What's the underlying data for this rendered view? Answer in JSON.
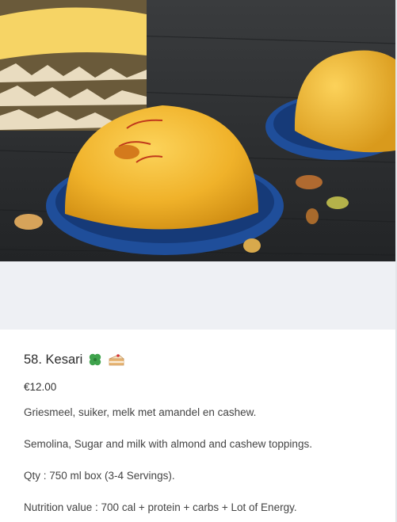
{
  "product": {
    "image_alt": "Kesari dessert",
    "title": "58. Kesari",
    "title_icons": [
      "four-leaf-clover-icon",
      "cake-slice-icon"
    ],
    "price": "€12.00",
    "description_lines": [
      "Griesmeel, suiker, melk met amandel en cashew.",
      "Semolina, Sugar and milk with almond and cashew toppings.",
      "Qty : 750 ml box (3-4 Servings).",
      "Nutrition value : 700 cal + protein + carbs + Lot of Energy."
    ]
  },
  "colors": {
    "background": "#ffffff",
    "placeholder_band": "#eef0f4",
    "dessert": "#f0b62a",
    "plate": "#1f4e9a",
    "wood": "#2f3133"
  }
}
